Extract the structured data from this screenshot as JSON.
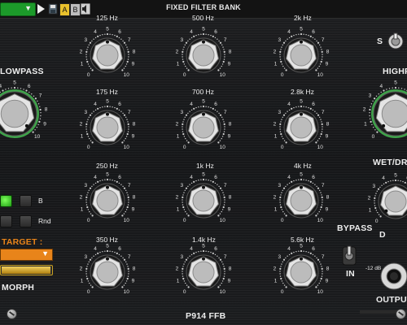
{
  "header": {
    "title": "FIXED FILTER BANK",
    "a_label": "A",
    "b_label": "B"
  },
  "colors": {
    "preset_green": "#1c9a2a",
    "ring_green": "#3fa34a",
    "target_orange": "#e8841a",
    "gold": "#c8a020"
  },
  "knob_scale": [
    "0",
    "1",
    "2",
    "3",
    "4",
    "5",
    "6",
    "7",
    "8",
    "9",
    "10"
  ],
  "side": {
    "lowpass": "LOWPASS",
    "highpass": "HIGHPASS",
    "wet_dry": "WET/DRY",
    "d_label": "D",
    "s_label": "S",
    "b_label": "B",
    "rnd_label": "Rnd",
    "target_label": "TARGET :",
    "morph_label": "MORPH",
    "bypass": "BYPASS",
    "in_label": "IN",
    "output": "OUTPUT GAIN",
    "db_mark": "-12 dB",
    "module_name": "P914 FFB"
  },
  "bands": {
    "col1": [
      "125 Hz",
      "175 Hz",
      "250 Hz",
      "350 Hz"
    ],
    "col2": [
      "500 Hz",
      "700 Hz",
      "1k Hz",
      "1.4k Hz"
    ],
    "col3": [
      "2k Hz",
      "2.8k Hz",
      "4k Hz",
      "5.6k Hz"
    ]
  },
  "knob_levels": {
    "band_knobs": [
      5,
      5,
      5,
      5,
      5,
      5,
      5,
      5,
      5,
      5,
      5,
      5
    ],
    "lowpass": 10,
    "highpass": 0,
    "wet_dry": 0
  }
}
